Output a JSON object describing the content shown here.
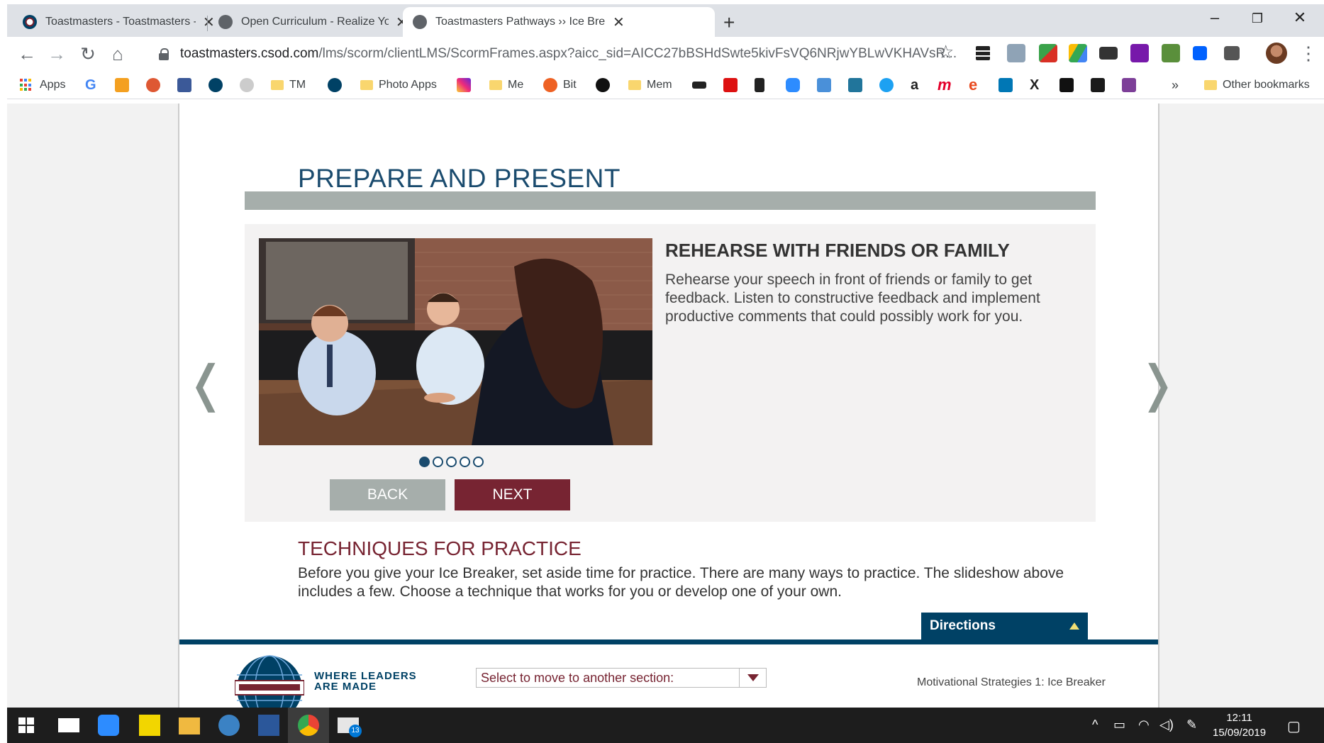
{
  "browser": {
    "tabs": [
      {
        "title": "Toastmasters - Toastmasters - Ha",
        "active": false
      },
      {
        "title": "Open Curriculum - Realize Your F",
        "active": false
      },
      {
        "title": "Toastmasters Pathways ›› Ice Brea",
        "active": true
      }
    ],
    "url_host": "toastmasters.csod.com",
    "url_path": "/lms/scorm/clientLMS/ScormFrames.aspx?aicc_sid=AICC27bBSHdSwte5kivFsVQ6NRjwYBLwVKHAVsR...",
    "bookmarks": [
      {
        "label": "Apps"
      },
      {
        "label": "TM"
      },
      {
        "label": "Photo Apps"
      },
      {
        "label": "Me"
      },
      {
        "label": "Bit"
      },
      {
        "label": "Mem"
      }
    ],
    "other_bookmarks": "Other bookmarks",
    "more_bookmarks": "»"
  },
  "page": {
    "title": "PREPARE AND PRESENT",
    "slide": {
      "heading": "REHEARSE WITH FRIENDS OR FAMILY",
      "text": "Rehearse your speech in front of friends or family to get feedback. Listen to constructive feedback and implement productive comments that could possibly work for you.",
      "current_index": 1,
      "total": 5
    },
    "back_label": "BACK",
    "next_label": "NEXT",
    "prev_arrow": "❬",
    "next_arrow": "❭",
    "section_heading": "TECHNIQUES FOR PRACTICE",
    "section_text": "Before you give your Ice Breaker, set aside time for practice. There are many ways to practice. The slideshow above includes a few. Choose a technique that works for you or develop one of your own.",
    "directions_label": "Directions"
  },
  "footer": {
    "tagline_line1": "WHERE LEADERS",
    "tagline_line2": "ARE MADE",
    "select_placeholder": "Select to move to another section:",
    "course_name": "Motivational Strategies 1: Ice Breaker"
  },
  "taskbar": {
    "time": "12:11",
    "date": "15/09/2019",
    "mail_badge": "13"
  },
  "colors": {
    "navy": "#004165",
    "maroon": "#772432",
    "gray": "#a6aeab"
  }
}
